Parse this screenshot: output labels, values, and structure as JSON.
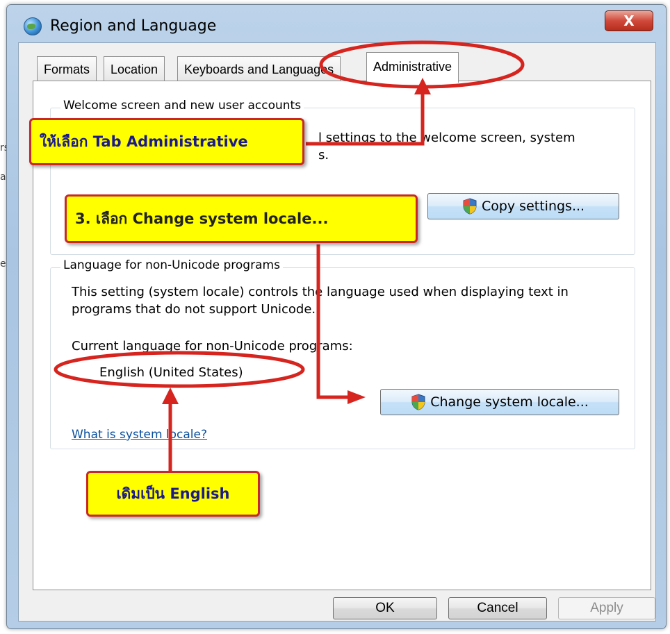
{
  "window": {
    "title": "Region and Language",
    "close_glyph": "X"
  },
  "tabs": [
    {
      "label": "Formats",
      "selected": false
    },
    {
      "label": "Location",
      "selected": false
    },
    {
      "label": "Keyboards and Languages",
      "selected": false
    },
    {
      "label": "Administrative",
      "selected": true
    }
  ],
  "welcome_group": {
    "title": "Welcome screen and new user accounts",
    "description_visible": "l settings to the welcome screen, system",
    "description_visible_line2": "s.",
    "copy_button": "Copy settings..."
  },
  "locale_group": {
    "title": "Language for non-Unicode programs",
    "description": "This setting (system locale) controls the language used when displaying text in programs that do not support Unicode.",
    "current_label": "Current language for non-Unicode programs:",
    "current_value": "English (United States)",
    "change_button": "Change system locale...",
    "help_link": "What is system locale?"
  },
  "dialog_buttons": {
    "ok": "OK",
    "cancel": "Cancel",
    "apply": "Apply"
  },
  "annotations": {
    "tab_callout": "ให้เลือก Tab Administrative",
    "step_callout": "3. เลือก Change system locale...",
    "english_callout": "เดิมเป็น English"
  },
  "background_cutoff": [
    "rs",
    "a",
    "e"
  ],
  "colors": {
    "callout_bg": "#ffff00",
    "annotation_red": "#d6241f",
    "link": "#0a4f9e",
    "titlebar": "#b5cde6"
  }
}
